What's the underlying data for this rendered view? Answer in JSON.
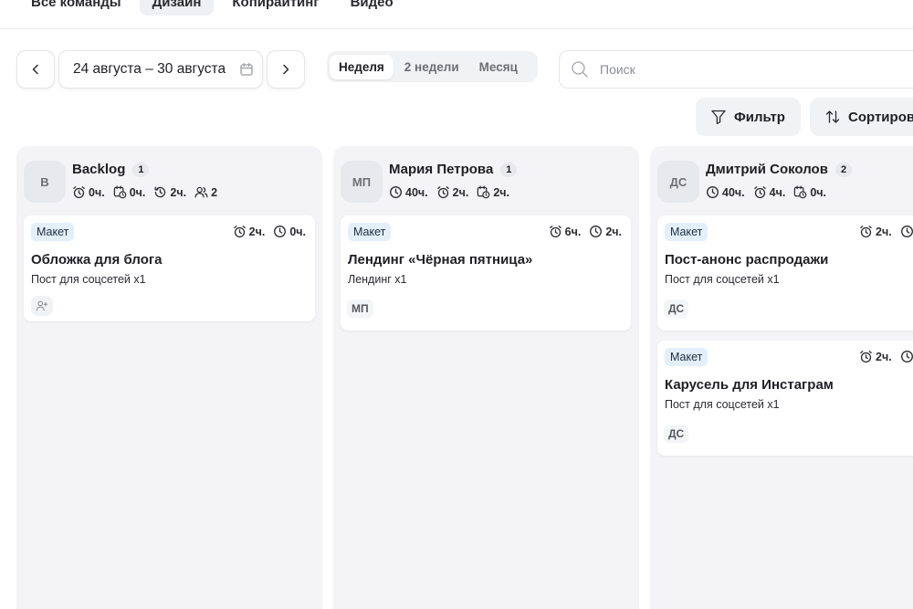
{
  "team_tabs": [
    {
      "label": "Все команды",
      "active": false
    },
    {
      "label": "Дизайн",
      "active": true
    },
    {
      "label": "Копирайтинг",
      "active": false
    },
    {
      "label": "Видео",
      "active": false
    }
  ],
  "toolbar": {
    "date_range": "24 августа – 30 августа",
    "periods": [
      {
        "label": "Неделя",
        "active": true
      },
      {
        "label": "2 недели",
        "active": false
      },
      {
        "label": "Месяц",
        "active": false
      }
    ],
    "search_placeholder": "Поиск",
    "filter_label": "Фильтр",
    "sort_label": "Сортиров"
  },
  "columns": [
    {
      "avatar": "В",
      "title": "Backlog",
      "count": "1",
      "stats": {
        "total": "0ч.",
        "planned": "0ч.",
        "spent": "2ч.",
        "members": "2"
      },
      "cards": [
        {
          "tag": "Макет",
          "time_estimate": "2ч.",
          "time_spent": "0ч.",
          "title": "Обложка для блога",
          "subtitle": "Пост для соцсетей x1",
          "assignee": ""
        }
      ]
    },
    {
      "avatar": "МП",
      "title": "Мария Петрова",
      "count": "1",
      "stats": {
        "total": "40ч.",
        "planned": "2ч.",
        "spent": "2ч."
      },
      "cards": [
        {
          "tag": "Макет",
          "time_estimate": "6ч.",
          "time_spent": "2ч.",
          "title": "Лендинг «Чёрная пятница»",
          "subtitle": "Лендинг x1",
          "assignee": "МП"
        }
      ]
    },
    {
      "avatar": "ДС",
      "title": "Дмитрий Соколов",
      "count": "2",
      "stats": {
        "total": "40ч.",
        "planned": "4ч.",
        "spent": "0ч."
      },
      "cards": [
        {
          "tag": "Макет",
          "time_estimate": "2ч.",
          "title": "Пост-анонс распродажи",
          "subtitle": "Пост для соцсетей x1",
          "assignee": "ДС"
        },
        {
          "tag": "Макет",
          "time_estimate": "2ч.",
          "title": "Карусель для Инстаграм",
          "subtitle": "Пост для соцсетей x1",
          "assignee": "ДС"
        }
      ]
    }
  ]
}
